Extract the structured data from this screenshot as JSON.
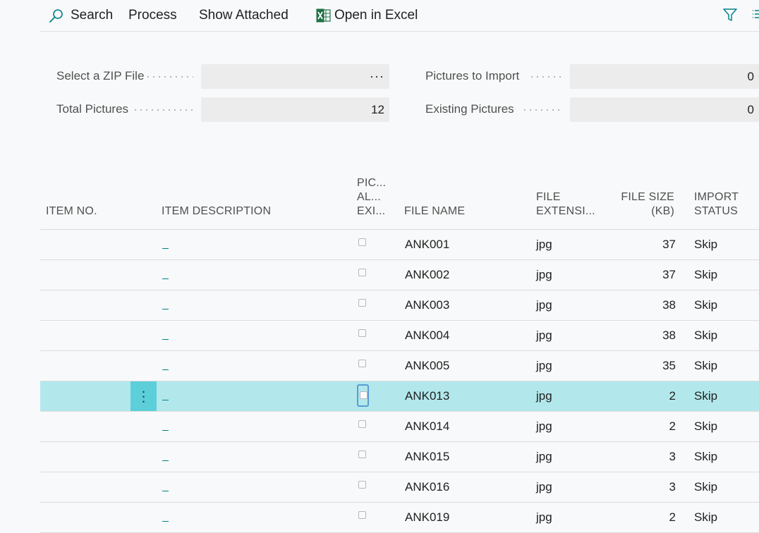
{
  "actions": {
    "search": "Search",
    "process": "Process",
    "show_attached": "Show Attached",
    "open_in_excel": "Open in Excel"
  },
  "fields": {
    "zip_file": {
      "label": "Select a ZIP File",
      "value": "···"
    },
    "total_pictures": {
      "label": "Total Pictures",
      "value": "12"
    },
    "pictures_to_import": {
      "label": "Pictures to Import",
      "value": "0"
    },
    "existing_pictures": {
      "label": "Existing Pictures",
      "value": "0"
    }
  },
  "table": {
    "headers": {
      "item_no": "ITEM NO.",
      "item_description": "ITEM DESCRIPTION",
      "pic_line1": "PIC...",
      "pic_line2": "AL...",
      "pic_line3": "EXI...",
      "file_name": "FILE NAME",
      "file_ext_line1": "FILE",
      "file_ext_line2": "EXTENSI...",
      "file_size_line1": "FILE SIZE",
      "file_size_line2": "(KB)",
      "import_status_line1": "IMPORT",
      "import_status_line2": "STATUS"
    },
    "rows": [
      {
        "file_name": "ANK001",
        "ext": "jpg",
        "size": "37",
        "status": "Skip"
      },
      {
        "file_name": "ANK002",
        "ext": "jpg",
        "size": "37",
        "status": "Skip"
      },
      {
        "file_name": "ANK003",
        "ext": "jpg",
        "size": "38",
        "status": "Skip"
      },
      {
        "file_name": "ANK004",
        "ext": "jpg",
        "size": "38",
        "status": "Skip"
      },
      {
        "file_name": "ANK005",
        "ext": "jpg",
        "size": "35",
        "status": "Skip"
      },
      {
        "file_name": "ANK013",
        "ext": "jpg",
        "size": "2",
        "status": "Skip"
      },
      {
        "file_name": "ANK014",
        "ext": "jpg",
        "size": "2",
        "status": "Skip"
      },
      {
        "file_name": "ANK015",
        "ext": "jpg",
        "size": "3",
        "status": "Skip"
      },
      {
        "file_name": "ANK016",
        "ext": "jpg",
        "size": "3",
        "status": "Skip"
      },
      {
        "file_name": "ANK019",
        "ext": "jpg",
        "size": "2",
        "status": "Skip"
      }
    ],
    "selected_row": 5
  },
  "colors": {
    "accent": "#00818a",
    "selected_row": "#b2e8ec",
    "row_menu": "#5ccfd8",
    "excel_green": "#1e7145"
  }
}
